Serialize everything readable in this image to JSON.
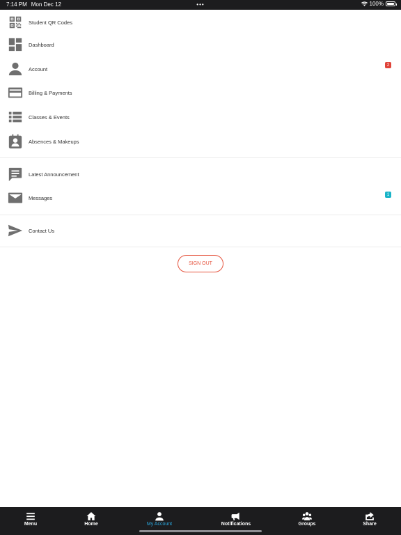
{
  "status_bar": {
    "time": "7:14 PM",
    "date": "Mon Dec 12",
    "dots": "•••",
    "battery": "100%",
    "battery_level": 1.0
  },
  "menu": {
    "items": [
      {
        "label": "Student QR Codes",
        "icon": "qr-code-icon"
      },
      {
        "label": "Dashboard",
        "icon": "dashboard-icon"
      },
      {
        "label": "Account",
        "icon": "person-icon",
        "badge": "2"
      },
      {
        "label": "Billing & Payments",
        "icon": "credit-card-icon"
      },
      {
        "label": "Classes & Events",
        "icon": "list-icon"
      },
      {
        "label": "Absences & Makeups",
        "icon": "contact-card-icon"
      },
      {
        "label": "Latest Announcement",
        "icon": "announcement-icon"
      },
      {
        "label": "Messages",
        "icon": "mail-icon",
        "badge": "1"
      },
      {
        "label": "Contact Us",
        "icon": "send-icon"
      }
    ]
  },
  "sign_out_label": "SIGN OUT",
  "colors": {
    "account_badge": "#e0443a",
    "messages_badge": "#1ab4c8",
    "sign_out": "#e5533d",
    "active_tab": "#29a8e0",
    "bar_background": "#1c1c1e"
  },
  "tabs": [
    {
      "label": "Menu",
      "icon": "menu-icon"
    },
    {
      "label": "Home",
      "icon": "home-icon"
    },
    {
      "label": "My Account",
      "icon": "account-icon",
      "active": true
    },
    {
      "label": "Notifications",
      "icon": "megaphone-icon"
    },
    {
      "label": "Groups",
      "icon": "groups-icon"
    },
    {
      "label": "Share",
      "icon": "share-icon"
    }
  ]
}
